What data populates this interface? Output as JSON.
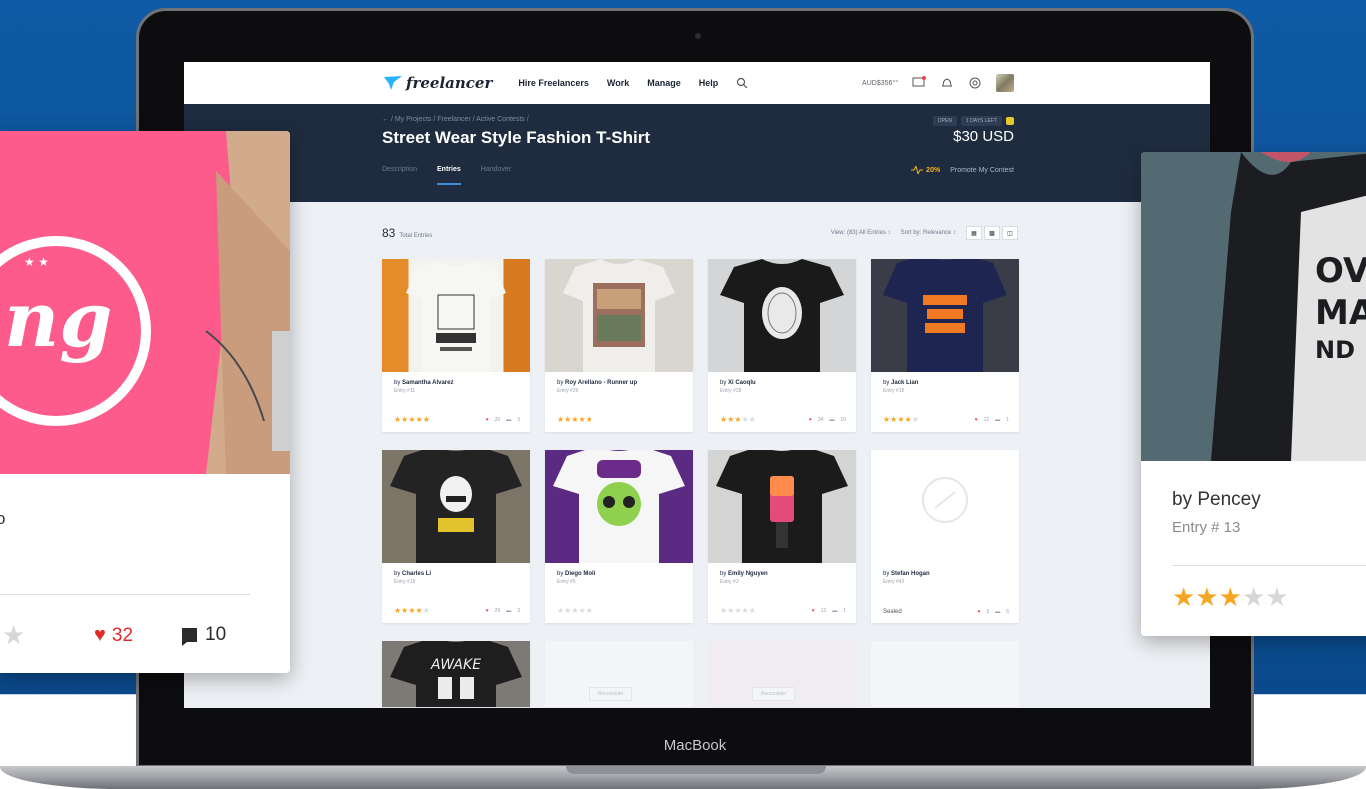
{
  "brand": {
    "logo": "freelancer",
    "laptop_label": "MacBook"
  },
  "nav": {
    "items": [
      "Hire Freelancers",
      "Work",
      "Manage",
      "Help"
    ],
    "balance": "AUD$356°°"
  },
  "contest": {
    "breadcrumb": "← / My Projects / Freelancer / Active Contests /",
    "status_pills": [
      "OPEN",
      "1 DAYS LEFT"
    ],
    "title": "Street Wear Style Fashion T-Shirt",
    "prize": "$30 USD",
    "tabs": [
      "Description",
      "Entries",
      "Handover"
    ],
    "active_tab": "Entries",
    "promo_percent": "20%",
    "promote_label": "Promote My Contest"
  },
  "toolbar": {
    "total_count": "83",
    "total_label": "Total Entries",
    "view_filter": "View: (83) All Entries ↕",
    "sort": "Sort by: Relevance ↕"
  },
  "entries": [
    {
      "by": "Samantha Alvarez",
      "entry": "Entry #11",
      "rating": 5,
      "likes": "20",
      "comments": "3"
    },
    {
      "by": "Roy Arellano - Runner up",
      "entry": "Entry #26",
      "rating": 5,
      "likes": "",
      "comments": ""
    },
    {
      "by": "Xi Caoqlu",
      "entry": "Entry #28",
      "rating": 3,
      "likes": "34",
      "comments": "10"
    },
    {
      "by": "Jack Lian",
      "entry": "Entry #15",
      "rating": 4,
      "likes": "12",
      "comments": "1"
    },
    {
      "by": "Charles Li",
      "entry": "Entry #19",
      "rating": 4,
      "likes": "29",
      "comments": "3"
    },
    {
      "by": "Diego Moli",
      "entry": "Entry #5",
      "rating": 0,
      "likes": "",
      "comments": ""
    },
    {
      "by": "Emily Nguyen",
      "entry": "Entry #3",
      "rating": 0,
      "likes": "12",
      "comments": "1"
    },
    {
      "by": "Stefan Hogan",
      "entry": "Entry #42",
      "rating": null,
      "sealed": "Sealed",
      "likes": "5",
      "comments": "6"
    }
  ],
  "reconsider_label": "Reconsider",
  "awake_text": "AWAKE",
  "float_left": {
    "by": "o",
    "likes": "32",
    "comments": "10"
  },
  "float_right": {
    "by": "by Pencey",
    "entry": "Entry # 13",
    "rating": 3
  },
  "colors": {
    "accent": "#3d8de0",
    "star": "#f5a623",
    "heart": "#e02b2b",
    "header": "#1f2c3f"
  }
}
